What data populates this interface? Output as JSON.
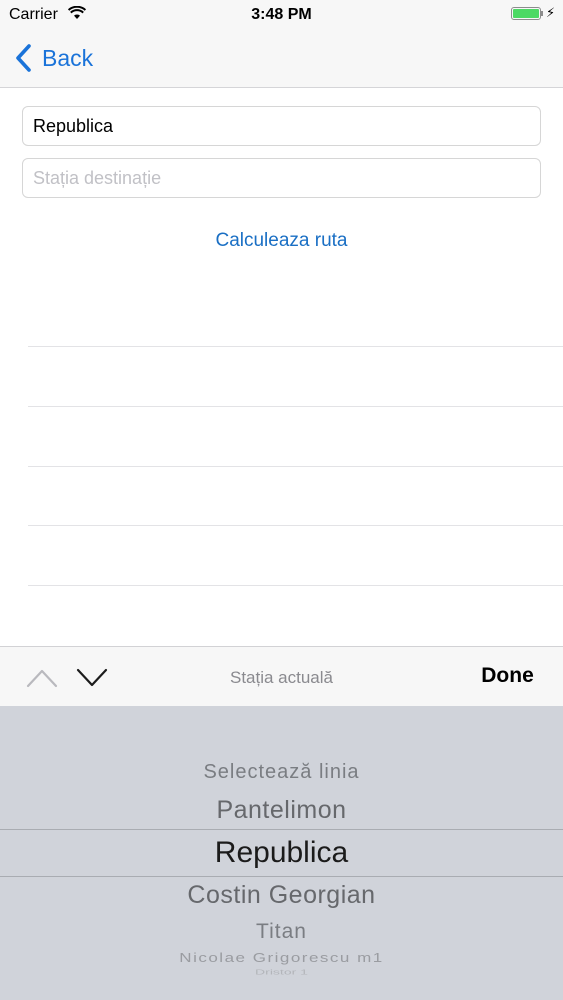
{
  "status_bar": {
    "carrier": "Carrier",
    "time": "3:48 PM",
    "battery_color": "#4cd964"
  },
  "nav": {
    "back_label": "Back",
    "accent_color": "#1a73d9"
  },
  "form": {
    "origin_value": "Republica",
    "destination_placeholder": "Stația destinație",
    "calculate_label": "Calculeaza ruta"
  },
  "accessory": {
    "title": "Stația actuală",
    "done_label": "Done"
  },
  "picker": {
    "items": [
      "Selectează linia",
      "Pantelimon",
      "Republica",
      "Costin Georgian",
      "Titan",
      "Nicolae Grigorescu m1",
      "Dristor 1"
    ],
    "selected": "Republica"
  }
}
